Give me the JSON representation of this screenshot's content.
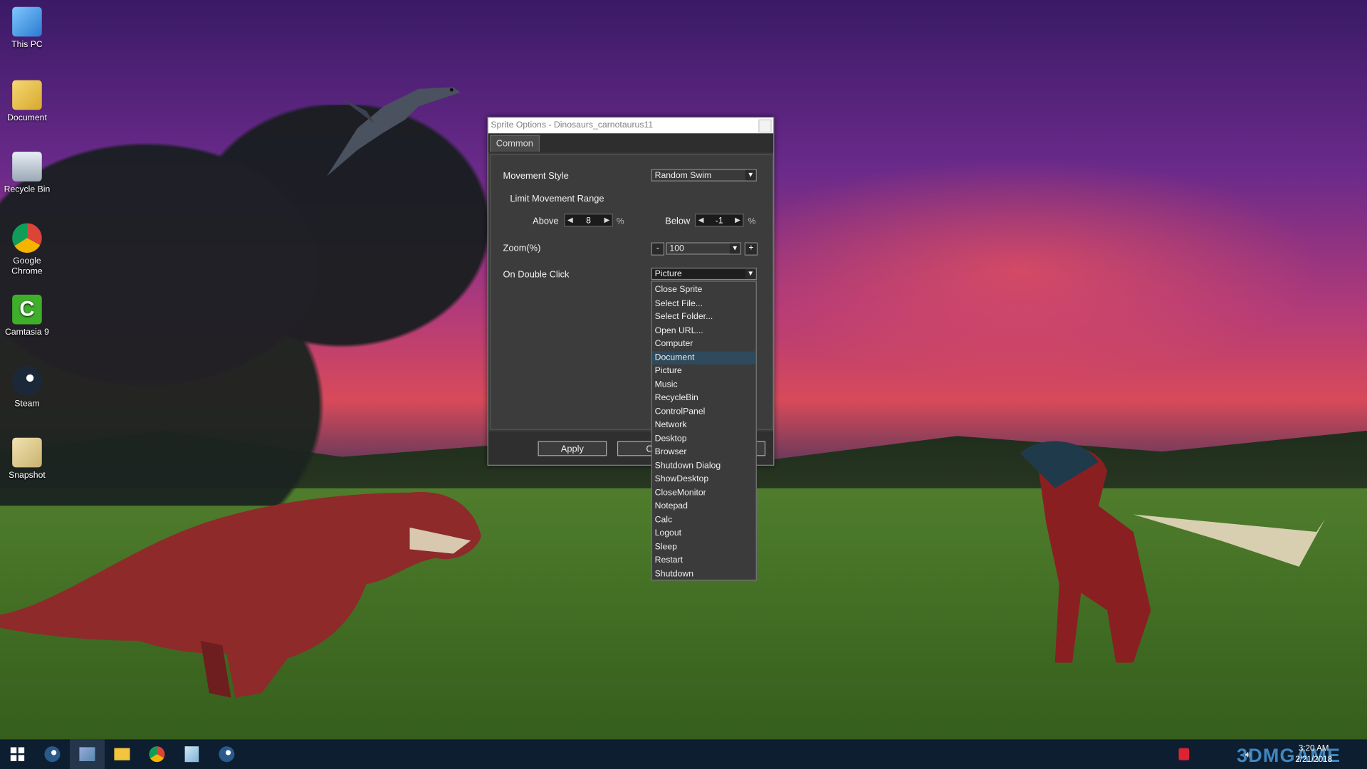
{
  "desktop": {
    "icons": [
      {
        "label": "This PC",
        "icon": "computer-icon"
      },
      {
        "label": "Document",
        "icon": "document-folder-icon"
      },
      {
        "label": "Recycle Bin",
        "icon": "recycle-bin-icon"
      },
      {
        "label": "Google\nChrome",
        "icon": "chrome-icon"
      },
      {
        "label": "Camtasia 9",
        "icon": "camtasia-icon"
      },
      {
        "label": "Steam",
        "icon": "steam-icon"
      },
      {
        "label": "Snapshot",
        "icon": "snapshot-icon"
      }
    ]
  },
  "dialog": {
    "title": "Sprite Options - Dinosaurs_carnotaurus11",
    "tab": "Common",
    "movement_style": {
      "label": "Movement Style",
      "value": "Random Swim"
    },
    "limit_label": "Limit Movement Range",
    "above": {
      "label": "Above",
      "value": "8",
      "unit": "%"
    },
    "below": {
      "label": "Below",
      "value": "-1",
      "unit": "%"
    },
    "zoom": {
      "label": "Zoom(%)",
      "minus": "-",
      "value": "100",
      "plus": "+"
    },
    "double_click": {
      "label": "On Double Click",
      "value": "Picture"
    },
    "apply": "Apply",
    "cancel_partial": "C"
  },
  "dropdown": {
    "items": [
      "Close Sprite",
      "Select File...",
      "Select Folder...",
      "Open URL...",
      "Computer",
      "Document",
      "Picture",
      "Music",
      "RecycleBin",
      "ControlPanel",
      "Network",
      "Desktop",
      "Browser",
      "Shutdown Dialog",
      "ShowDesktop",
      "CloseMonitor",
      "Notepad",
      "Calc",
      "Logout",
      "Sleep",
      "Restart",
      "Shutdown"
    ],
    "highlighted": "Document"
  },
  "taskbar": {
    "apps": [
      "windows-start-icon",
      "steam-icon",
      "sprite-app-icon",
      "file-explorer-icon",
      "chrome-icon",
      "notepad-icon",
      "steam-icon"
    ],
    "time": "3:20 AM",
    "date": "2/21/2018",
    "watermark": "3DMGAME"
  },
  "colors": {
    "taskbar": "#0c1e30",
    "dialog": "#3a3a3a",
    "selection": "#2e4a5c"
  }
}
